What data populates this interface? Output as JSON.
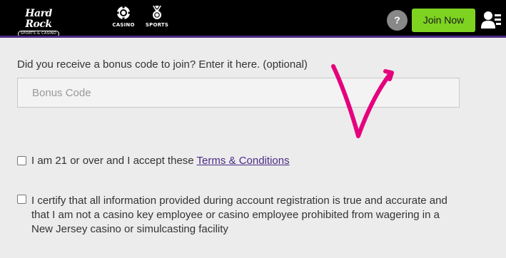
{
  "header": {
    "logo": {
      "main": "Hard Rock",
      "sub": "SPORTS & CASINO"
    },
    "nav": [
      {
        "label": "CASINO",
        "icon": "casino-chip-icon"
      },
      {
        "label": "SPORTS",
        "icon": "sports-medal-icon"
      }
    ],
    "help_label": "?",
    "join_label": "Join Now",
    "account_icon": "account-icon",
    "colors": {
      "bar": "#000000",
      "accent_line": "#4a2b86",
      "join": "#7ed321",
      "help": "#888888"
    }
  },
  "bonus": {
    "label": "Did you receive a bonus code to join? Enter it here. (optional)",
    "placeholder": "Bonus Code",
    "value": ""
  },
  "checks": {
    "age": {
      "checked": false,
      "text": "I am 21 or over and I accept these ",
      "link": "Terms & Conditions"
    },
    "certify": {
      "checked": false,
      "text": "I certify that all information provided during account registration is true and accurate and that I am not a casino key employee or casino employee prohibited from wagering in a New Jersey casino or simulcasting facility"
    }
  },
  "annotation": {
    "shape": "checkmark",
    "color": "#e5007d"
  }
}
